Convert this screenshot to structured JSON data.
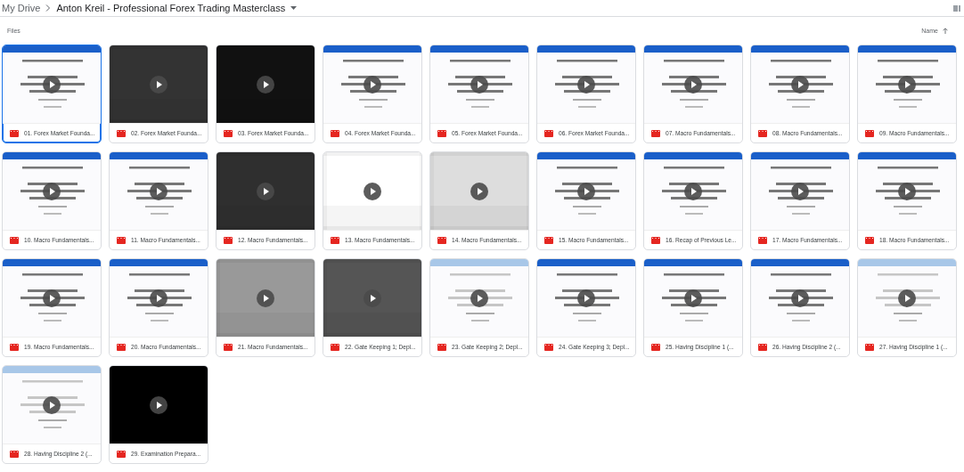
{
  "breadcrumb": {
    "items": [
      {
        "label": "My Drive"
      },
      {
        "label": "Anton Kreil - Professional Forex Trading Masterclass"
      }
    ]
  },
  "section": {
    "title": "Files"
  },
  "sort": {
    "label": "Name"
  },
  "files": [
    {
      "name": "01. Forex Market Founda...",
      "selected": true
    },
    {
      "name": "02. Forex Market Founda...",
      "selected": false
    },
    {
      "name": "03. Forex Market Founda...",
      "selected": false
    },
    {
      "name": "04. Forex Market Founda...",
      "selected": false
    },
    {
      "name": "05. Forex Market Founda...",
      "selected": false
    },
    {
      "name": "06. Forex Market Founda...",
      "selected": false
    },
    {
      "name": "07. Macro Fundamentals...",
      "selected": false
    },
    {
      "name": "08. Macro Fundamentals...",
      "selected": false
    },
    {
      "name": "09. Macro Fundamentals...",
      "selected": false
    },
    {
      "name": "10. Macro Fundamentals...",
      "selected": false
    },
    {
      "name": "11. Macro Fundamentals...",
      "selected": false
    },
    {
      "name": "12. Macro Fundamentals...",
      "selected": false
    },
    {
      "name": "13. Macro Fundamentals...",
      "selected": false
    },
    {
      "name": "14. Macro Fundamentals...",
      "selected": false
    },
    {
      "name": "15. Macro Fundamentals...",
      "selected": false
    },
    {
      "name": "16. Recap of Previous Le...",
      "selected": false
    },
    {
      "name": "17. Macro Fundamentals...",
      "selected": false
    },
    {
      "name": "18. Macro Fundamentals...",
      "selected": false
    },
    {
      "name": "19. Macro Fundamentals...",
      "selected": false
    },
    {
      "name": "20. Macro Fundamentals...",
      "selected": false
    },
    {
      "name": "21. Macro Fundamentals...",
      "selected": false
    },
    {
      "name": "22. Gate Keeping 1; Depl...",
      "selected": false
    },
    {
      "name": "23. Gate Keeping 2; Depl...",
      "selected": false
    },
    {
      "name": "24. Gate Keeping 3; Depl...",
      "selected": false
    },
    {
      "name": "25. Having Discipline 1 (...",
      "selected": false
    },
    {
      "name": "26. Having Discipline 2 (...",
      "selected": false
    },
    {
      "name": "27. Having Discipline 1 (...",
      "selected": false
    },
    {
      "name": "28. Having Discipline 2 (...",
      "selected": false
    },
    {
      "name": "29. Examination Prepara...",
      "selected": false
    }
  ]
}
